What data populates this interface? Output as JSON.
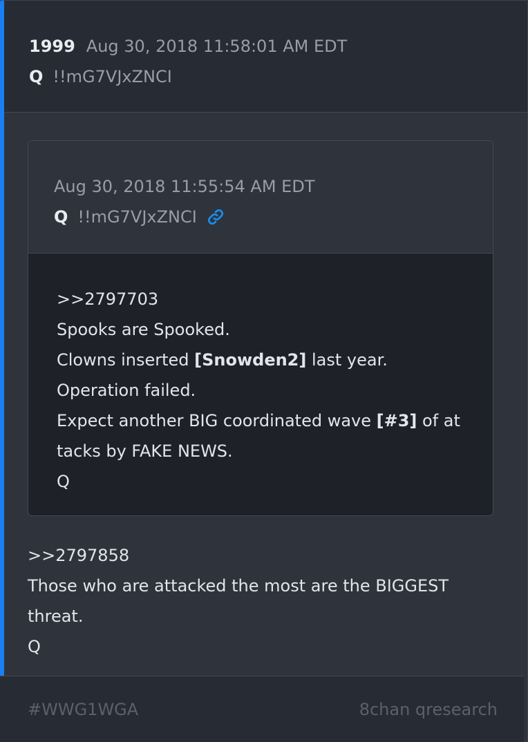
{
  "post": {
    "number": "1999",
    "date": "Aug 30, 2018 11:58:01 AM EDT",
    "author": "Q",
    "tripcode": "!!mG7VJxZNCI",
    "body": {
      "line1": ">>2797858",
      "line2": "Those who are attacked the most are the BIGGEST",
      "line3": "threat.",
      "line4": "Q"
    }
  },
  "quoted": {
    "date": "Aug 30, 2018 11:55:54 AM EDT",
    "author": "Q",
    "tripcode": "!!mG7VJxZNCI",
    "link_icon": "link-icon",
    "body": {
      "line1": ">>2797703",
      "line2": "Spooks are Spooked.",
      "line3_pre": "Clowns inserted ",
      "line3_bold": "[Snowden2]",
      "line3_post": " last year.",
      "line4": "Operation failed.",
      "line5_pre": "Expect another BIG coordinated wave ",
      "line5_bold": "[#3]",
      "line5_post": " of at",
      "line6": "tacks by FAKE NEWS.",
      "line7": "Q"
    }
  },
  "footer": {
    "hashtag": "#WWG1WGA",
    "source": "8chan qresearch"
  },
  "colors": {
    "accent": "#1a7ff0",
    "link": "#1a8be8",
    "background": "#2e333c",
    "header": "#272b33",
    "quoted_body": "#1e2127"
  }
}
